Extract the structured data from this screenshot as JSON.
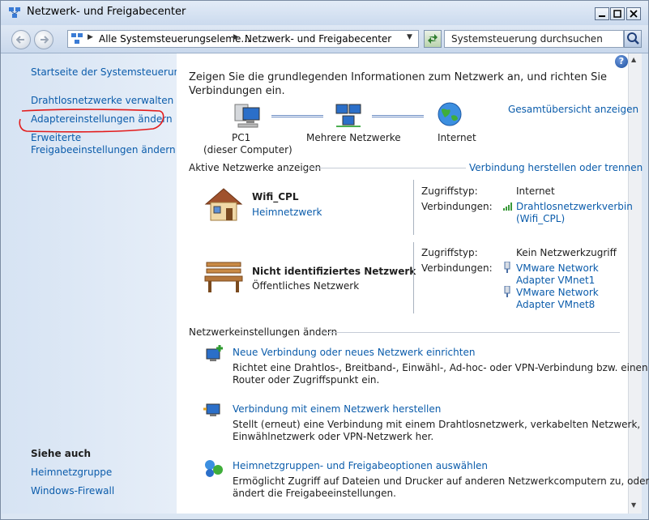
{
  "window": {
    "title": "Netzwerk- und Freigabecenter"
  },
  "address": {
    "crumbs": [
      "Alle Systemsteuerungseleme...",
      "Netzwerk- und Freigabecenter"
    ],
    "search_placeholder": "Systemsteuerung durchsuchen"
  },
  "sidebar": {
    "links": [
      "Startseite der Systemsteuerung",
      "Drahtlosnetzwerke verwalten",
      "Adaptereinstellungen ändern",
      "Erweiterte",
      "Freigabeeinstellungen ändern"
    ],
    "see_also_title": "Siehe auch",
    "see_also": [
      "Heimnetzgruppe",
      "Windows-Firewall"
    ]
  },
  "main": {
    "intro_line1": "Zeigen Sie die grundlegenden Informationen zum Netzwerk an, und richten Sie",
    "intro_line2": "Verbindungen ein.",
    "full_map": "Gesamtübersicht anzeigen",
    "map": {
      "pc_name": "PC1",
      "pc_sub": "(dieser Computer)",
      "network": "Mehrere Netzwerke",
      "internet": "Internet"
    },
    "active_title": "Aktive Netzwerke anzeigen",
    "connect_link": "Verbindung herstellen oder trennen",
    "net1": {
      "name": "Wifi_CPL",
      "type": "Heimnetzwerk",
      "access_label": "Zugriffstyp:",
      "access_value": "Internet",
      "conn_label": "Verbindungen:",
      "conn_line1": "Drahtlosnetzwerkverbin",
      "conn_line2": "(Wifi_CPL)"
    },
    "net2": {
      "name": "Nicht identifiziertes Netzwerk",
      "type": "Öffentliches Netzwerk",
      "access_label": "Zugriffstyp:",
      "access_value": "Kein Netzwerkzugriff",
      "conn_label": "Verbindungen:",
      "conn1_line1": "VMware Network",
      "conn1_line2": "Adapter VMnet1",
      "conn2_line1": "VMware Network",
      "conn2_line2": "Adapter VMnet8"
    },
    "settings_title": "Netzwerkeinstellungen ändern",
    "tasks": [
      {
        "title": "Neue Verbindung oder neues Netzwerk einrichten",
        "desc1": "Richtet eine Drahtlos-, Breitband-, Einwähl-, Ad-hoc- oder VPN-Verbindung bzw. einen",
        "desc2": "Router oder Zugriffspunkt ein."
      },
      {
        "title": "Verbindung mit einem Netzwerk herstellen",
        "desc1": "Stellt (erneut) eine Verbindung mit einem Drahtlosnetzwerk, verkabelten Netzwerk,",
        "desc2": "Einwählnetzwerk oder VPN-Netzwerk her."
      },
      {
        "title": "Heimnetzgruppen- und Freigabeoptionen auswählen",
        "desc1": "Ermöglicht Zugriff auf Dateien und Drucker auf anderen Netzwerkcomputern zu, oder",
        "desc2": "ändert die Freigabeeinstellungen."
      }
    ]
  }
}
